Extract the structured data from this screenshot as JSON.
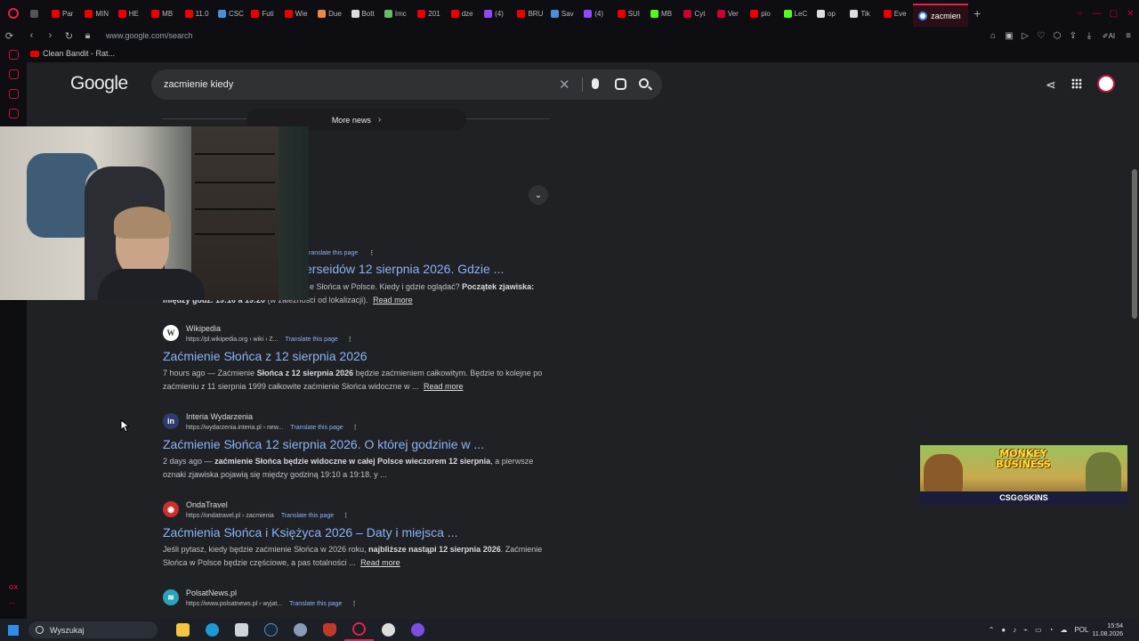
{
  "browser": {
    "tabs": [
      {
        "label": "Par",
        "color": "#e00"
      },
      {
        "label": "MIN",
        "color": "#e00"
      },
      {
        "label": "HE",
        "color": "#e00"
      },
      {
        "label": "MB",
        "color": "#e00"
      },
      {
        "label": "11.0",
        "color": "#e00"
      },
      {
        "label": "CSC",
        "color": "#4a8fd8"
      },
      {
        "label": "Futi",
        "color": "#e00"
      },
      {
        "label": "Wie",
        "color": "#e00"
      },
      {
        "label": "Due",
        "color": "#e84"
      },
      {
        "label": "Bott",
        "color": "#ddd"
      },
      {
        "label": "Imc",
        "color": "#6b6"
      },
      {
        "label": "201",
        "color": "#e00"
      },
      {
        "label": "dze",
        "color": "#e00"
      },
      {
        "label": "(4)",
        "color": "#9146ff"
      },
      {
        "label": "BRU",
        "color": "#e00"
      },
      {
        "label": "Sav",
        "color": "#4a8fd8"
      },
      {
        "label": "(4)",
        "color": "#9146ff"
      },
      {
        "label": "SUI",
        "color": "#e00"
      },
      {
        "label": "MB",
        "color": "#53fc18"
      },
      {
        "label": "Cyt",
        "color": "#c03"
      },
      {
        "label": "Ver",
        "color": "#c03"
      },
      {
        "label": "pio",
        "color": "#e00"
      },
      {
        "label": "LeC",
        "color": "#53fc18"
      },
      {
        "label": "op",
        "color": "#ddd"
      },
      {
        "label": "Tik",
        "color": "#ddd"
      },
      {
        "label": "Eve",
        "color": "#e00"
      }
    ],
    "active_tab": "zacmien",
    "url": "www.google.com/search",
    "bookmark": "Clean Bandit - Rat...",
    "sidebar_label": "GX"
  },
  "google": {
    "logo": "Google",
    "query": "zacmienie kiedy",
    "more_news": "More news"
  },
  "partial_result": {
    "translate": "ranslate this page",
    "title": "erseidów 12 sierpnia 2026. Gdzie ...",
    "snippet_1": "e Słońca w Polsce. Kiedy i gdzie oglądać?",
    "snippet_1_bold": "Początek zjawiska:",
    "snippet_2_bold": "między godz. 19:10 a 19:20",
    "snippet_2": "(w zależności od lokalizacji).",
    "read_more": "Read more"
  },
  "results": [
    {
      "favicon": "W",
      "site": "Wikipedia",
      "url": "https://pl.wikipedia.org › wiki › Z...",
      "translate": "Translate this page",
      "title": "Zaćmienie Słońca z 12 sierpnia 2026",
      "snippet_a": "7 hours ago — Zaćmienie",
      "snippet_b": "Słońca z 12 sierpnia 2026",
      "snippet_c": "będzie zaćmieniem całkowitym. Będzie to kolejne po zaćmieniu z 11 sierpnia 1999 całkowite zaćmienie Słońca widoczne w ...",
      "read_more": "Read more"
    },
    {
      "favicon": "in",
      "site": "Interia Wydarzenia",
      "url": "https://wydarzenia.interia.pl › new...",
      "translate": "Translate this page",
      "title": "Zaćmienie Słońca 12 sierpnia 2026. O której godzinie w ...",
      "snippet_a": "2 days ago —",
      "snippet_b": "zaćmienie Słońca będzie widoczne w całej Polsce wieczorem 12 sierpnia",
      "snippet_c": ", a pierwsze oznaki zjawiska pojawią się między godziną 19:10 a 19:18. y ...",
      "read_more": ""
    },
    {
      "favicon": "◉",
      "site": "OndaTravel",
      "url": "https://ondatravel.pl › zacmienia",
      "translate": "Translate this page",
      "title": "Zaćmienia Słońca i Księżyca 2026 – Daty i miejsca ...",
      "snippet_a": "Jeśli pytasz, kiedy będzie zaćmienie Słońca w 2026 roku,",
      "snippet_b": "najbliższe nastąpi 12 sierpnia 2026",
      "snippet_c": ". Zaćmienie Słońca w Polsce będzie częściowe, a pas totalności ...",
      "read_more": "Read more"
    },
    {
      "favicon": "≋",
      "site": "PolsatNews.pl",
      "url": "https://www.polsatnews.pl › wyjat...",
      "translate": "Translate this page",
      "title": "",
      "snippet_a": "",
      "snippet_b": "",
      "snippet_c": "",
      "read_more": ""
    }
  ],
  "ad": {
    "title": "MONKEY BUSINESS",
    "brand": "CSG⊙SKINS"
  },
  "taskbar": {
    "search_placeholder": "Wyszukaj",
    "language": "POL",
    "time": "15:54",
    "date": "11.08.2026"
  }
}
